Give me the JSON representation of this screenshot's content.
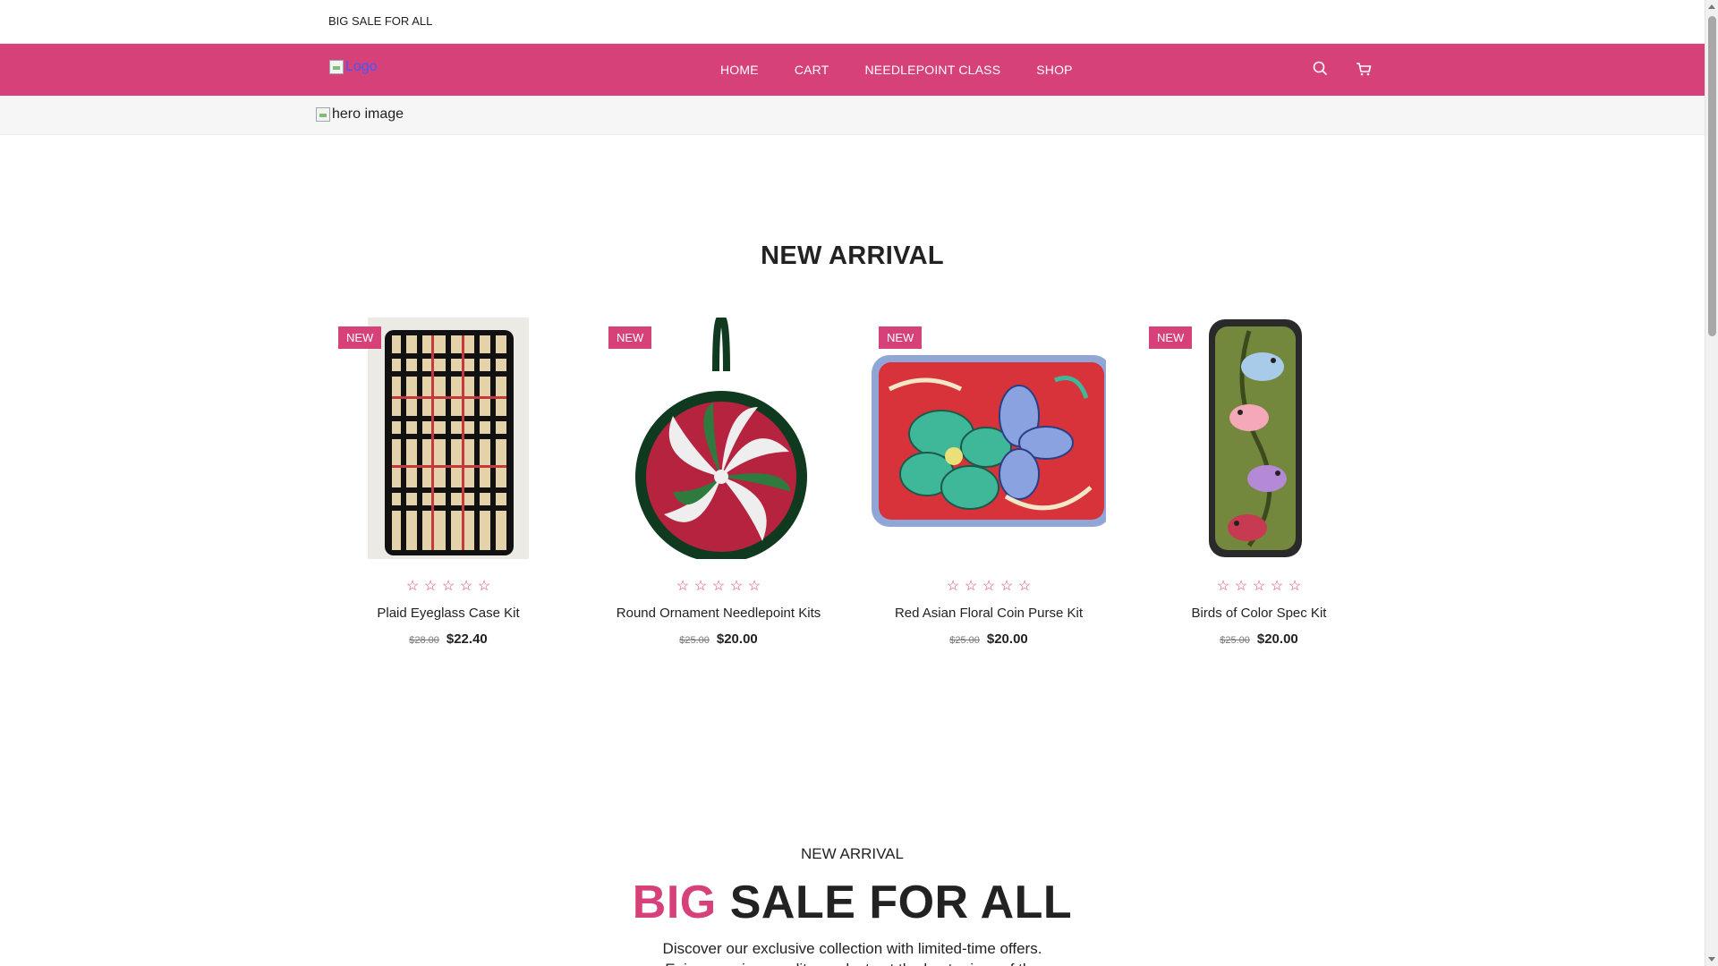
{
  "topbar": {
    "promo": "BIG SALE FOR ALL"
  },
  "nav": {
    "logo_alt": "Logo",
    "links": [
      "HOME",
      "CART",
      "NEEDLEPOINT CLASS",
      "SHOP"
    ],
    "icons": [
      "search-icon",
      "cart-icon"
    ],
    "accent_color": "#d7417a"
  },
  "hero": {
    "alt": "hero image"
  },
  "new_arrival": {
    "title": "NEW ARRIVAL",
    "products": [
      {
        "badge": "NEW",
        "name": "Plaid Eyeglass Case Kit",
        "old_price": "$28.00",
        "price": "$22.40",
        "rating": 0
      },
      {
        "badge": "NEW",
        "name": "Round Ornament Needlepoint Kits",
        "old_price": "$25.00",
        "price": "$20.00",
        "rating": 0
      },
      {
        "badge": "NEW",
        "name": "Red Asian Floral Coin Purse Kit",
        "old_price": "$25.00",
        "price": "$20.00",
        "rating": 0
      },
      {
        "badge": "NEW",
        "name": "Birds of Color Spec Kit",
        "old_price": "$25.00",
        "price": "$20.00",
        "rating": 0
      }
    ]
  },
  "sale": {
    "kicker": "NEW ARRIVAL",
    "headline_accent": "BIG",
    "headline_rest": "SALE FOR ALL",
    "description_line1": "Discover our exclusive collection with limited-time offers.",
    "description_line2": "Enjoy premium quality products at the best prices of the"
  }
}
